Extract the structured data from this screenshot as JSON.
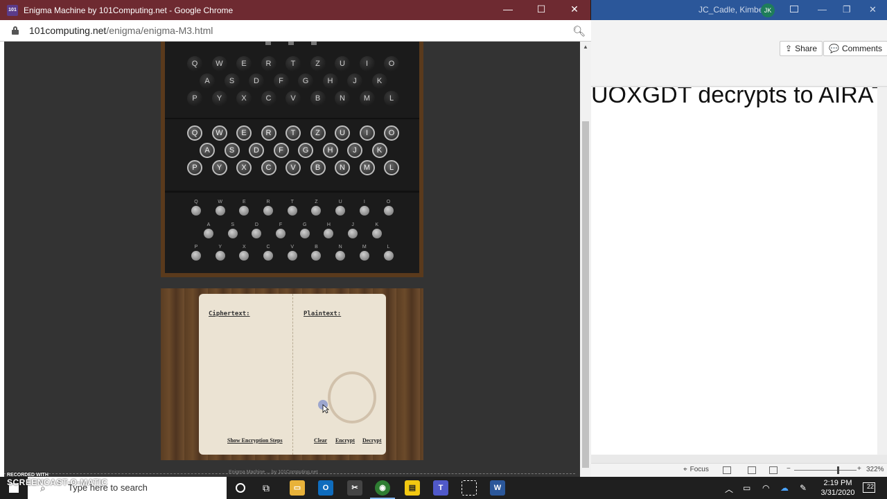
{
  "word": {
    "user_name": "JC_Cadle, Kimberly",
    "user_initials": "JK",
    "share_label": "Share",
    "comments_label": "Comments",
    "doc_text": "UOXGDT decrypts to AIRAT",
    "focus_label": "Focus",
    "zoom_minus": "−",
    "zoom_plus": "+",
    "zoom_percent": "322%"
  },
  "chrome": {
    "favicon_text": "101",
    "title": "Enigma Machine by 101Computing.net - Google Chrome",
    "url_domain": "101computing.net",
    "url_path": "/enigma/enigma-M3.html",
    "minimize": "—",
    "maximize": "☐",
    "close": "✕"
  },
  "enigma": {
    "rows": [
      [
        "Q",
        "W",
        "E",
        "R",
        "T",
        "Z",
        "U",
        "I",
        "O"
      ],
      [
        "A",
        "S",
        "D",
        "F",
        "G",
        "H",
        "J",
        "K"
      ],
      [
        "P",
        "Y",
        "X",
        "C",
        "V",
        "B",
        "N",
        "M",
        "L"
      ]
    ]
  },
  "notebook": {
    "ciphertext_label": "Ciphertext:",
    "plaintext_label": "Plaintext:",
    "show_steps_label": "Show Encryption Steps",
    "clear_label": "Clear",
    "encrypt_label": "Encrypt",
    "decrypt_label": "Decrypt"
  },
  "footer": {
    "text": "Enigma Machine ... by 101Computing.net"
  },
  "taskbar": {
    "search_placeholder": "Type here to search",
    "clock_time": "2:19 PM",
    "clock_date": "3/31/2020",
    "notification_count": "22",
    "apps": [
      "file-explorer",
      "outlook",
      "snipping",
      "chrome",
      "sticky-notes",
      "teams",
      "snip-sketch",
      "word"
    ]
  },
  "watermark": {
    "line1": "RECORDED WITH",
    "line2": "SCREENCAST-O-MATIC"
  }
}
